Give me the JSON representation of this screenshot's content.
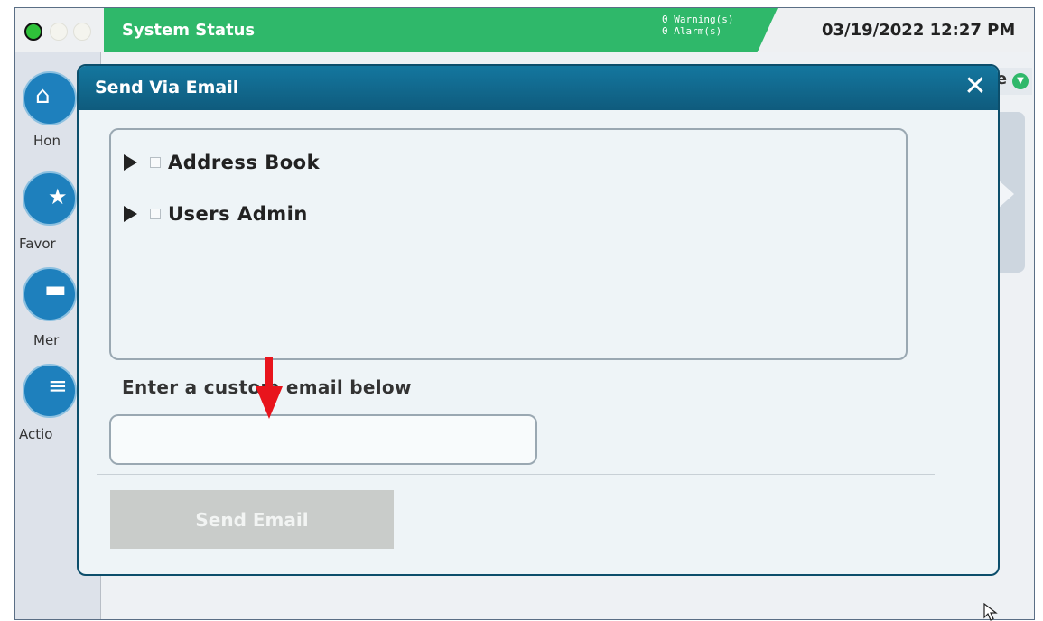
{
  "topbar": {
    "status_title": "System Status",
    "warnings": "0 Warning(s)",
    "alarms": "0 Alarm(s)",
    "datetime": "03/19/2022 12:27 PM"
  },
  "sidebar": {
    "items": [
      {
        "label": "Hon",
        "icon": "home-icon"
      },
      {
        "label": "Favor",
        "icon": "star-icon"
      },
      {
        "label": "Mer",
        "icon": "menu-icon"
      },
      {
        "label": "Actio",
        "icon": "actions-icon"
      }
    ]
  },
  "background": {
    "pill_text": "re"
  },
  "modal": {
    "title": "Send Via Email",
    "close_glyph": "✕",
    "recipients": [
      {
        "label": "Address Book",
        "checked": false
      },
      {
        "label": "Users Admin",
        "checked": false
      }
    ],
    "custom_email_label": "Enter a custom email below",
    "custom_email_value": "",
    "send_label": "Send Email"
  },
  "colors": {
    "status_green": "#2fb86a",
    "modal_header": "#14779f",
    "annotation_arrow": "#e8141c"
  }
}
